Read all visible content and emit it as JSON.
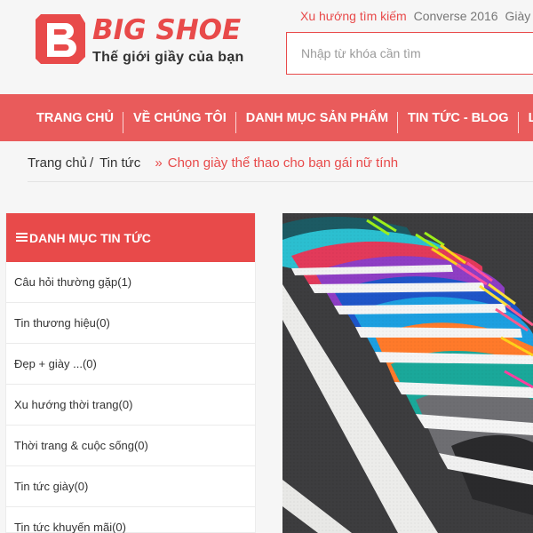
{
  "brand": {
    "logo_letter": "B",
    "name": "BIG SHOE",
    "tagline": "Thế giới giầy của bạn",
    "accent_color": "#e84a4a",
    "nav_color": "#e95b5b"
  },
  "trending": {
    "label": "Xu hướng tìm kiếm",
    "items": [
      "Converse 2016",
      "Giày"
    ]
  },
  "search": {
    "placeholder": "Nhập từ khóa cần tìm"
  },
  "nav": {
    "items": [
      "TRANG CHỦ",
      "VỀ CHÚNG TÔI",
      "DANH MỤC SẢN PHẨM",
      "TIN TỨC - BLOG",
      "LIÊN HỆ"
    ]
  },
  "breadcrumb": {
    "home": "Trang chủ",
    "separator": "/",
    "section": "Tin tức",
    "arrow": "»",
    "current": "Chọn giày thể thao cho bạn gái nữ tính"
  },
  "sidebar": {
    "title": "DANH MỤC TIN TỨC",
    "items": [
      "Câu hỏi thường gặp(1)",
      "Tin thương hiệu(0)",
      "Đẹp + giày ...(0)",
      "Xu hướng thời trang(0)",
      "Thời trang & cuộc sống(0)",
      "Tin tức giày(0)",
      "Tin tức khuyến mãi(0)"
    ]
  },
  "hero": {
    "icon": "sneakers-photo"
  }
}
